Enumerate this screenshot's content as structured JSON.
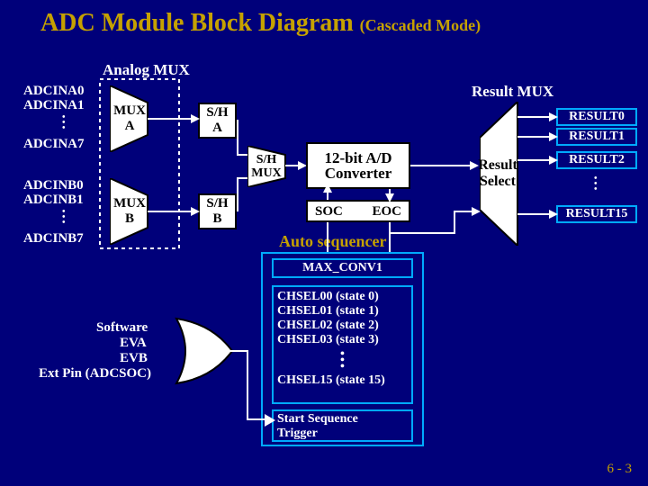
{
  "title": "ADC Module Block Diagram",
  "subtitle": "(Cascaded Mode)",
  "analog_mux_label": "Analog MUX",
  "result_mux_label": "Result MUX",
  "inputs_a": [
    "ADCINA0",
    "ADCINA1",
    "ADCINA7"
  ],
  "inputs_b": [
    "ADCINB0",
    "ADCINB1",
    "ADCINB7"
  ],
  "mux_a": "MUX\nA",
  "mux_b": "MUX\nB",
  "sh_a": "S/H\nA",
  "sh_b": "S/H\nB",
  "sh_mux": "S/H\nMUX",
  "converter": "12-bit A/D\nConverter",
  "soc": "SOC",
  "eoc": "EOC",
  "auto_seq": "Auto sequencer",
  "max_conv": "MAX_CONV1",
  "chsel": [
    "CHSEL00 (state 0)",
    "CHSEL01 (state 1)",
    "CHSEL02 (state 2)",
    "CHSEL03 (state 3)",
    "CHSEL15 (state 15)"
  ],
  "start_trig": "Start Sequence\nTrigger",
  "triggers": [
    "Software",
    "EVA",
    "EVB",
    "Ext Pin (ADCSOC)"
  ],
  "result_select": "Result\nSelect",
  "results": [
    "RESULT0",
    "RESULT1",
    "RESULT2",
    "RESULT15"
  ],
  "page": "6 - 3"
}
